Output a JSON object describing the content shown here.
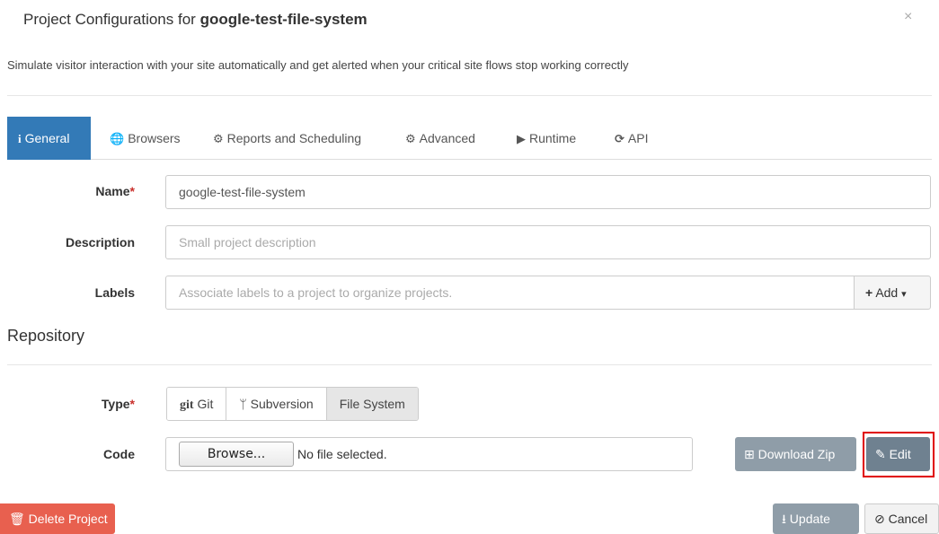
{
  "dialog": {
    "title_prefix": "Project Configurations for",
    "project_name": "google-test-file-system",
    "close": "×",
    "subtitle": "Simulate visitor interaction with your site automatically and get alerted when your critical site flows stop working correctly"
  },
  "tabs": [
    {
      "icon": "i",
      "label": "General",
      "active": true
    },
    {
      "icon": "🌐",
      "label": "Browsers"
    },
    {
      "icon": "⚙",
      "label": "Reports and Scheduling"
    },
    {
      "icon": "⚙",
      "label": "Advanced"
    },
    {
      "icon": "▶",
      "label": "Runtime"
    },
    {
      "icon": "⟳",
      "label": "API"
    }
  ],
  "form": {
    "name_label": "Name",
    "required_mark": "*",
    "name_value": "google-test-file-system",
    "description_label": "Description",
    "description_placeholder": "Small project description",
    "labels_label": "Labels",
    "labels_placeholder": "Associate labels to a project to organize projects.",
    "add_label": "Add",
    "add_icon": "+",
    "add_caret": "▾"
  },
  "repository": {
    "heading": "Repository",
    "type_label": "Type",
    "types": [
      {
        "icon": "git",
        "label": "Git"
      },
      {
        "icon": "ᛘ",
        "label": "Subversion"
      },
      {
        "icon": "",
        "label": "File System",
        "active": true
      }
    ],
    "code_label": "Code",
    "browse_label": "Browse...",
    "no_file": "No file selected.",
    "download_zip": "Download Zip",
    "edit": "Edit"
  },
  "footer": {
    "delete_project": "Delete Project",
    "update": "Update",
    "cancel": "Cancel"
  }
}
